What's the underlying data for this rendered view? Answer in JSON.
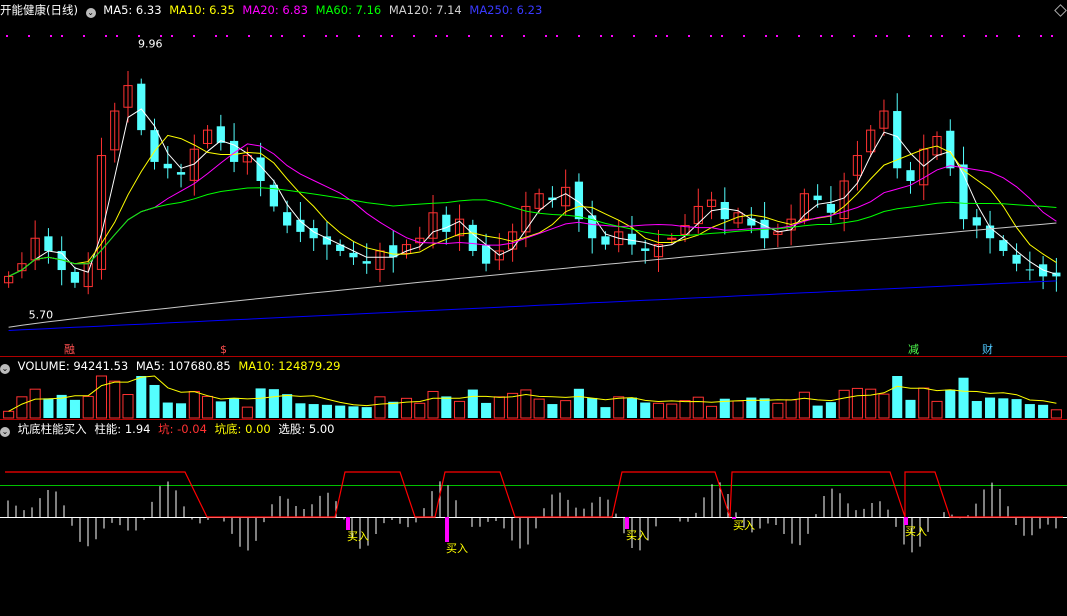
{
  "price_panel": {
    "title": "开能健康(日线)",
    "ma5": "MA5: 6.33",
    "ma10": "MA10: 6.35",
    "ma20": "MA20: 6.83",
    "ma60": "MA60: 7.16",
    "ma120": "MA120: 7.14",
    "ma250": "MA250: 6.23",
    "high_label": "9.96",
    "low_label": "5.70",
    "event_markers": [
      "融",
      "$",
      "减",
      "财"
    ]
  },
  "volume_panel": {
    "label": "VOLUME: 94241.53",
    "ma5": "MA5: 107680.85",
    "ma10": "MA10: 124879.29"
  },
  "indicator_panel": {
    "name": "坑底柱能买入",
    "zhuneng": "柱能: 1.94",
    "keng": "坑: -0.04",
    "kengdi": "坑底: 0.00",
    "xuangu": "选股: 5.00",
    "buy_label": "买入"
  },
  "colors": {
    "up": "#ff3232",
    "down": "#54ffff",
    "ma5": "#ffffff",
    "ma10": "#ffff00",
    "ma20": "#ff00ff",
    "ma60": "#00ff00",
    "ma120": "#c8c8c8",
    "ma250": "#0000ff",
    "divider": "#b00000",
    "buy_bar": "#ff00ff",
    "trap_line": "#ff0000",
    "threshold_line": "#00c000"
  },
  "chart_data": [
    {
      "type": "candlestick",
      "title": "开能健康(日线)",
      "y_range": [
        5.3,
        10.3
      ],
      "high": 9.96,
      "low": 5.7,
      "moving_averages": {
        "MA5": 6.33,
        "MA10": 6.35,
        "MA20": 6.83,
        "MA60": 7.16,
        "MA120": 7.14,
        "MA250": 6.23
      },
      "closes": [
        6.3,
        6.5,
        6.9,
        6.7,
        6.4,
        6.2,
        6.5,
        8.2,
        8.9,
        9.3,
        8.6,
        8.1,
        8.0,
        7.9,
        8.3,
        8.6,
        8.4,
        8.1,
        8.2,
        7.8,
        7.4,
        7.1,
        7.0,
        6.9,
        6.8,
        6.7,
        6.6,
        6.5,
        6.7,
        6.6,
        6.8,
        6.9,
        7.3,
        7.0,
        7.2,
        6.7,
        6.5,
        6.7,
        7.0,
        7.4,
        7.6,
        7.5,
        7.7,
        7.2,
        6.9,
        6.8,
        7.0,
        6.8,
        6.7,
        6.8,
        6.9,
        7.1,
        7.4,
        7.5,
        7.2,
        7.3,
        7.1,
        6.9,
        7.0,
        7.2,
        7.6,
        7.5,
        7.3,
        7.8,
        8.2,
        8.6,
        8.9,
        8.0,
        7.8,
        8.3,
        8.5,
        8.0,
        7.2,
        7.1,
        6.9,
        6.7,
        6.5,
        6.4,
        6.3,
        6.3
      ],
      "ylim": [
        5.3,
        10.3
      ]
    },
    {
      "type": "bar",
      "title": "VOLUME",
      "current": 94241.53,
      "MA5": 107680.85,
      "MA10": 124879.29
    },
    {
      "type": "bar",
      "title": "坑底柱能买入",
      "zhuneng": 1.94,
      "keng": -0.04,
      "kengdi": 0.0,
      "xuangu": 5.0,
      "buy_signal_indices": [
        25,
        33,
        46,
        54,
        67
      ],
      "buy_label": "买入"
    }
  ]
}
